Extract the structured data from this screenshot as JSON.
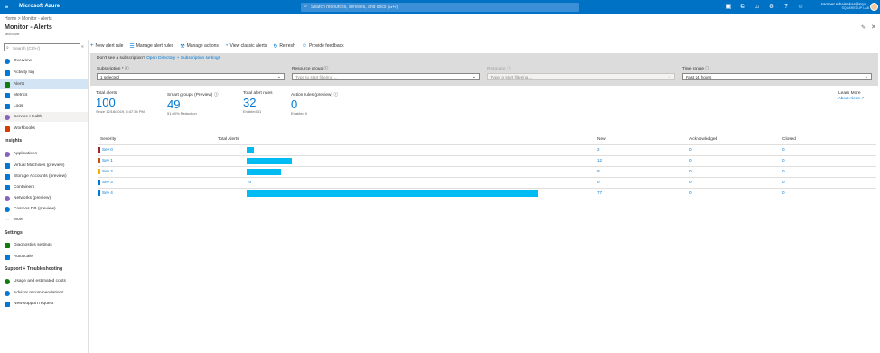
{
  "header": {
    "brand": "Microsoft Azure",
    "search_placeholder": "Search resources, services, and docs (G+/)",
    "user_email": "sameer.mhaisekar@squ...",
    "user_tenant": "SQUAREDUP LAB",
    "icons": [
      "cloud-shell-icon",
      "directory-filter-icon",
      "notifications-icon",
      "settings-icon",
      "help-icon",
      "feedback-icon"
    ]
  },
  "breadcrumb": {
    "home": "Home",
    "sep": ">",
    "current": "Monitor - Alerts"
  },
  "page": {
    "title": "Monitor - Alerts",
    "subtitle": "Microsoft"
  },
  "sidebar": {
    "search_placeholder": "Search (Ctrl+/)",
    "collapse_glyph": "«",
    "items_top": [
      {
        "label": "Overview",
        "color": "#0078d4"
      },
      {
        "label": "Activity log",
        "color": "#0078d4"
      },
      {
        "label": "Alerts",
        "color": "#107c10",
        "active": true
      },
      {
        "label": "Metrics",
        "color": "#0078d4"
      },
      {
        "label": "Logs",
        "color": "#0078d4"
      },
      {
        "label": "Service Health",
        "color": "#8764b8",
        "hover": true
      },
      {
        "label": "Workbooks",
        "color": "#d83b01"
      }
    ],
    "insights_heading": "Insights",
    "items_insights": [
      {
        "label": "Applications",
        "color": "#8764b8"
      },
      {
        "label": "Virtual Machines (preview)",
        "color": "#0078d4"
      },
      {
        "label": "Storage Accounts (preview)",
        "color": "#0078d4"
      },
      {
        "label": "Containers",
        "color": "#0078d4"
      },
      {
        "label": "Networks (preview)",
        "color": "#8764b8"
      },
      {
        "label": "Cosmos DB (preview)",
        "color": "#0078d4"
      },
      {
        "label": "More",
        "color": "#8a8886"
      }
    ],
    "settings_heading": "Settings",
    "items_settings": [
      {
        "label": "Diagnostics settings",
        "color": "#107c10"
      },
      {
        "label": "Autoscale",
        "color": "#0078d4"
      }
    ],
    "support_heading": "Support + Troubleshooting",
    "items_support": [
      {
        "label": "Usage and estimated costs",
        "color": "#107c10"
      },
      {
        "label": "Advisor recommendations",
        "color": "#0078d4"
      },
      {
        "label": "New support request",
        "color": "#0078d4"
      }
    ]
  },
  "toolbar": {
    "new_alert_rule": "New alert rule",
    "manage_alert_rules": "Manage alert rules",
    "manage_actions": "Manage actions",
    "view_classic_alerts": "View classic alerts",
    "refresh": "Refresh",
    "provide_feedback": "Provide feedback"
  },
  "filters": {
    "note_text": "Don't see a subscription?",
    "note_link": "Open Directory + Subscription settings",
    "subscription": {
      "label": "Subscription * ⓘ",
      "value": "1 selected"
    },
    "resource_group": {
      "label": "Resource group ⓘ",
      "placeholder": "Type to start filtering ..."
    },
    "resource": {
      "label": "Resource ⓘ",
      "placeholder": "Type to start filtering ..."
    },
    "time_range": {
      "label": "Time range ⓘ",
      "value": "Past 24 hours"
    }
  },
  "stats": {
    "total_alerts": {
      "label": "Total alerts",
      "value": "100",
      "sub": "Since 12/18/2019, 6:47:34 PM"
    },
    "smart_groups": {
      "label": "Smart groups (Preview) ⓘ",
      "value": "49",
      "sub": "51.00% Reduction"
    },
    "total_alert_rules": {
      "label": "Total alert rules",
      "value": "32",
      "sub": "Enabled 31"
    },
    "action_rules": {
      "label": "Action rules (preview) ⓘ",
      "value": "0",
      "sub": "Enabled 0"
    },
    "learn_more": {
      "label": "Learn More",
      "link": "About Alerts ↗"
    }
  },
  "table": {
    "headers": {
      "severity": "Severity",
      "total": "Total Alerts",
      "new": "New",
      "acknowledged": "Acknowledged",
      "closed": "Closed"
    },
    "max_total": 77,
    "rows": [
      {
        "severity": "Sev 0",
        "color": "#a4262c",
        "total": "2",
        "total_value": 2,
        "new": "2",
        "acknowledged": "0",
        "closed": "0"
      },
      {
        "severity": "Sev 1",
        "color": "#ca5010",
        "total": "12",
        "total_value": 12,
        "new": "12",
        "acknowledged": "0",
        "closed": "0"
      },
      {
        "severity": "Sev 2",
        "color": "#f8b000",
        "total": "9",
        "total_value": 9,
        "new": "9",
        "acknowledged": "0",
        "closed": "0"
      },
      {
        "severity": "Sev 3",
        "color": "#0078d4",
        "total": "0",
        "total_value": 0,
        "new": "0",
        "acknowledged": "0",
        "closed": "0"
      },
      {
        "severity": "Sev 4",
        "color": "#0078d4",
        "total": "77",
        "total_value": 77,
        "new": "77",
        "acknowledged": "0",
        "closed": "0"
      }
    ]
  }
}
